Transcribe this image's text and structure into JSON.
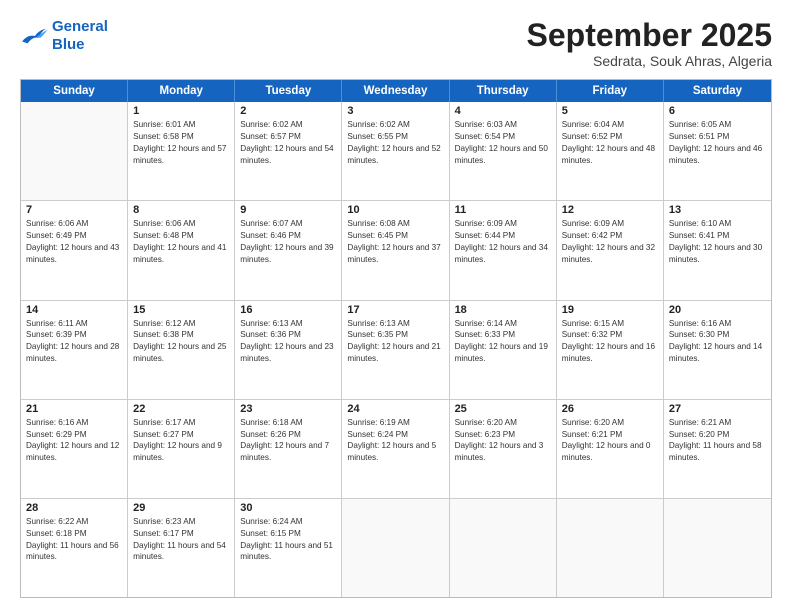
{
  "logo": {
    "line1": "General",
    "line2": "Blue"
  },
  "title": "September 2025",
  "subtitle": "Sedrata, Souk Ahras, Algeria",
  "header_days": [
    "Sunday",
    "Monday",
    "Tuesday",
    "Wednesday",
    "Thursday",
    "Friday",
    "Saturday"
  ],
  "weeks": [
    [
      {
        "day": "",
        "sunrise": "",
        "sunset": "",
        "daylight": ""
      },
      {
        "day": "1",
        "sunrise": "Sunrise: 6:01 AM",
        "sunset": "Sunset: 6:58 PM",
        "daylight": "Daylight: 12 hours and 57 minutes."
      },
      {
        "day": "2",
        "sunrise": "Sunrise: 6:02 AM",
        "sunset": "Sunset: 6:57 PM",
        "daylight": "Daylight: 12 hours and 54 minutes."
      },
      {
        "day": "3",
        "sunrise": "Sunrise: 6:02 AM",
        "sunset": "Sunset: 6:55 PM",
        "daylight": "Daylight: 12 hours and 52 minutes."
      },
      {
        "day": "4",
        "sunrise": "Sunrise: 6:03 AM",
        "sunset": "Sunset: 6:54 PM",
        "daylight": "Daylight: 12 hours and 50 minutes."
      },
      {
        "day": "5",
        "sunrise": "Sunrise: 6:04 AM",
        "sunset": "Sunset: 6:52 PM",
        "daylight": "Daylight: 12 hours and 48 minutes."
      },
      {
        "day": "6",
        "sunrise": "Sunrise: 6:05 AM",
        "sunset": "Sunset: 6:51 PM",
        "daylight": "Daylight: 12 hours and 46 minutes."
      }
    ],
    [
      {
        "day": "7",
        "sunrise": "Sunrise: 6:06 AM",
        "sunset": "Sunset: 6:49 PM",
        "daylight": "Daylight: 12 hours and 43 minutes."
      },
      {
        "day": "8",
        "sunrise": "Sunrise: 6:06 AM",
        "sunset": "Sunset: 6:48 PM",
        "daylight": "Daylight: 12 hours and 41 minutes."
      },
      {
        "day": "9",
        "sunrise": "Sunrise: 6:07 AM",
        "sunset": "Sunset: 6:46 PM",
        "daylight": "Daylight: 12 hours and 39 minutes."
      },
      {
        "day": "10",
        "sunrise": "Sunrise: 6:08 AM",
        "sunset": "Sunset: 6:45 PM",
        "daylight": "Daylight: 12 hours and 37 minutes."
      },
      {
        "day": "11",
        "sunrise": "Sunrise: 6:09 AM",
        "sunset": "Sunset: 6:44 PM",
        "daylight": "Daylight: 12 hours and 34 minutes."
      },
      {
        "day": "12",
        "sunrise": "Sunrise: 6:09 AM",
        "sunset": "Sunset: 6:42 PM",
        "daylight": "Daylight: 12 hours and 32 minutes."
      },
      {
        "day": "13",
        "sunrise": "Sunrise: 6:10 AM",
        "sunset": "Sunset: 6:41 PM",
        "daylight": "Daylight: 12 hours and 30 minutes."
      }
    ],
    [
      {
        "day": "14",
        "sunrise": "Sunrise: 6:11 AM",
        "sunset": "Sunset: 6:39 PM",
        "daylight": "Daylight: 12 hours and 28 minutes."
      },
      {
        "day": "15",
        "sunrise": "Sunrise: 6:12 AM",
        "sunset": "Sunset: 6:38 PM",
        "daylight": "Daylight: 12 hours and 25 minutes."
      },
      {
        "day": "16",
        "sunrise": "Sunrise: 6:13 AM",
        "sunset": "Sunset: 6:36 PM",
        "daylight": "Daylight: 12 hours and 23 minutes."
      },
      {
        "day": "17",
        "sunrise": "Sunrise: 6:13 AM",
        "sunset": "Sunset: 6:35 PM",
        "daylight": "Daylight: 12 hours and 21 minutes."
      },
      {
        "day": "18",
        "sunrise": "Sunrise: 6:14 AM",
        "sunset": "Sunset: 6:33 PM",
        "daylight": "Daylight: 12 hours and 19 minutes."
      },
      {
        "day": "19",
        "sunrise": "Sunrise: 6:15 AM",
        "sunset": "Sunset: 6:32 PM",
        "daylight": "Daylight: 12 hours and 16 minutes."
      },
      {
        "day": "20",
        "sunrise": "Sunrise: 6:16 AM",
        "sunset": "Sunset: 6:30 PM",
        "daylight": "Daylight: 12 hours and 14 minutes."
      }
    ],
    [
      {
        "day": "21",
        "sunrise": "Sunrise: 6:16 AM",
        "sunset": "Sunset: 6:29 PM",
        "daylight": "Daylight: 12 hours and 12 minutes."
      },
      {
        "day": "22",
        "sunrise": "Sunrise: 6:17 AM",
        "sunset": "Sunset: 6:27 PM",
        "daylight": "Daylight: 12 hours and 9 minutes."
      },
      {
        "day": "23",
        "sunrise": "Sunrise: 6:18 AM",
        "sunset": "Sunset: 6:26 PM",
        "daylight": "Daylight: 12 hours and 7 minutes."
      },
      {
        "day": "24",
        "sunrise": "Sunrise: 6:19 AM",
        "sunset": "Sunset: 6:24 PM",
        "daylight": "Daylight: 12 hours and 5 minutes."
      },
      {
        "day": "25",
        "sunrise": "Sunrise: 6:20 AM",
        "sunset": "Sunset: 6:23 PM",
        "daylight": "Daylight: 12 hours and 3 minutes."
      },
      {
        "day": "26",
        "sunrise": "Sunrise: 6:20 AM",
        "sunset": "Sunset: 6:21 PM",
        "daylight": "Daylight: 12 hours and 0 minutes."
      },
      {
        "day": "27",
        "sunrise": "Sunrise: 6:21 AM",
        "sunset": "Sunset: 6:20 PM",
        "daylight": "Daylight: 11 hours and 58 minutes."
      }
    ],
    [
      {
        "day": "28",
        "sunrise": "Sunrise: 6:22 AM",
        "sunset": "Sunset: 6:18 PM",
        "daylight": "Daylight: 11 hours and 56 minutes."
      },
      {
        "day": "29",
        "sunrise": "Sunrise: 6:23 AM",
        "sunset": "Sunset: 6:17 PM",
        "daylight": "Daylight: 11 hours and 54 minutes."
      },
      {
        "day": "30",
        "sunrise": "Sunrise: 6:24 AM",
        "sunset": "Sunset: 6:15 PM",
        "daylight": "Daylight: 11 hours and 51 minutes."
      },
      {
        "day": "",
        "sunrise": "",
        "sunset": "",
        "daylight": ""
      },
      {
        "day": "",
        "sunrise": "",
        "sunset": "",
        "daylight": ""
      },
      {
        "day": "",
        "sunrise": "",
        "sunset": "",
        "daylight": ""
      },
      {
        "day": "",
        "sunrise": "",
        "sunset": "",
        "daylight": ""
      }
    ]
  ]
}
